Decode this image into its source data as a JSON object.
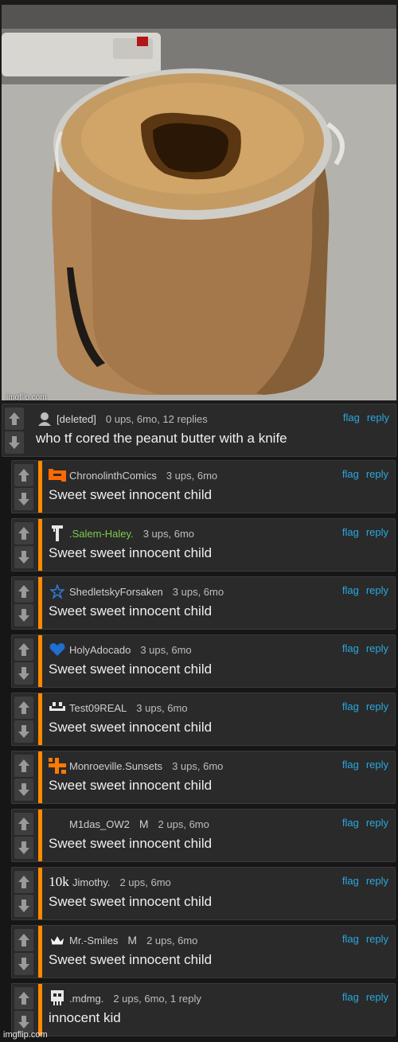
{
  "image": {
    "watermark": "imgflip.com",
    "subject": "peanut-butter-jar-icon"
  },
  "root_comment": {
    "username": "[deleted]",
    "meta": "0 ups, 6mo, 12 replies",
    "text": "who tf cored the peanut butter with a knife",
    "flag_label": "flag",
    "reply_label": "reply"
  },
  "replies": [
    {
      "username": "ChronolinthComics",
      "meta": "3 ups, 6mo",
      "text": "Sweet sweet innocent child",
      "avatar": "orange-pixel-icon",
      "mod": ""
    },
    {
      "username": ".Salem-Haley.",
      "meta": "3 ups, 6mo",
      "text": "Sweet sweet innocent child",
      "avatar": "white-pillar-icon",
      "mod": "",
      "name_color": "#7ecb4c"
    },
    {
      "username": "ShedletskyForsaken",
      "meta": "3 ups, 6mo",
      "text": "Sweet sweet innocent child",
      "avatar": "blue-star-icon",
      "mod": ""
    },
    {
      "username": "HolyAdocado",
      "meta": "3 ups, 6mo",
      "text": "Sweet sweet innocent child",
      "avatar": "blue-heart-icon",
      "mod": ""
    },
    {
      "username": "Test09REAL",
      "meta": "3 ups, 6mo",
      "text": "Sweet sweet innocent child",
      "avatar": "white-smiley-icon",
      "mod": ""
    },
    {
      "username": "Monroeville.Sunsets",
      "meta": "3 ups, 6mo",
      "text": "Sweet sweet innocent child",
      "avatar": "orange-glyph-icon",
      "mod": ""
    },
    {
      "username": "M1das_OW2",
      "meta": "2 ups, 6mo",
      "text": "Sweet sweet innocent child",
      "avatar": "none",
      "mod": "M"
    },
    {
      "username": "Jimothy.",
      "meta": "2 ups, 6mo",
      "text": "Sweet sweet innocent child",
      "avatar": "10k-text-icon",
      "avatar_text": "10k",
      "mod": ""
    },
    {
      "username": "Mr.-Smiles",
      "meta": "2 ups, 6mo",
      "text": "Sweet sweet innocent child",
      "avatar": "crown-icon",
      "mod": "M"
    },
    {
      "username": ".mdmg.",
      "meta": "2 ups, 6mo, 1 reply",
      "text": "innocent kid",
      "avatar": "pixel-skull-icon",
      "mod": ""
    }
  ],
  "labels": {
    "flag": "flag",
    "reply": "reply"
  },
  "footer": {
    "watermark": "imgflip.com"
  },
  "colors": {
    "accent": "#ff8a00",
    "link": "#29a8e0",
    "panel": "#2a2a2a",
    "background": "#161616"
  }
}
